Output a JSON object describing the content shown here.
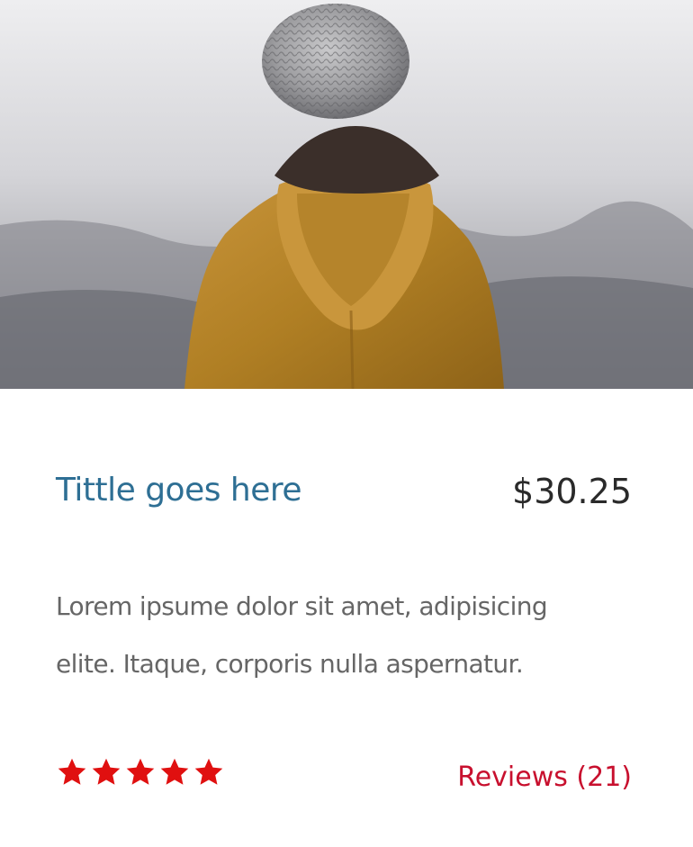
{
  "card": {
    "title": "Tittle goes here",
    "price": "$30.25",
    "description_lines": [
      "Lorem ipsume dolor sit amet, adipisicing",
      "elite. Itaque, corporis nulla aspernatur."
    ],
    "rating": {
      "value": 5,
      "max": 5,
      "star_color": "#e01010",
      "icon": "star-icon"
    },
    "reviews_link": "Reviews (21)"
  },
  "colors": {
    "title": "#2e6f94",
    "price": "#2a2a2a",
    "description": "#666666",
    "reviews": "#c8102e",
    "jacket": "#b8862a",
    "beanie": "#9a9a9c"
  }
}
